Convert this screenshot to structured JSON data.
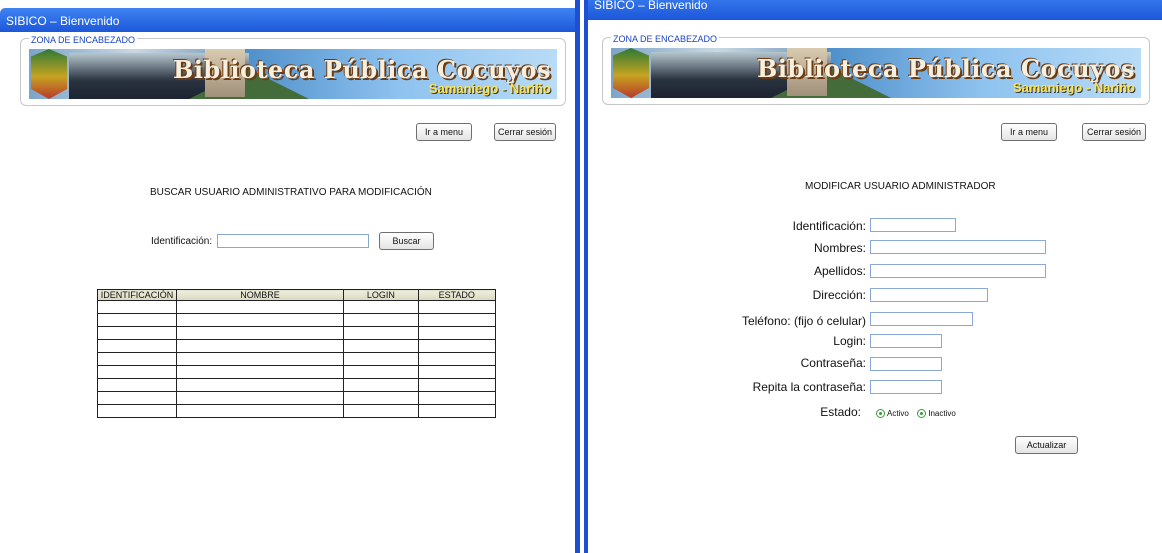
{
  "left": {
    "window_title": "SIBICO – Bienvenido",
    "header_zone_label": "ZONA DE ENCABEZADO",
    "banner_title": "Biblioteca Pública Cocuyos",
    "banner_subtitle": "Samaniego - Nariño",
    "menu_button": "Ir a menu",
    "logout_button": "Cerrar sesión",
    "heading": "BUSCAR USUARIO ADMINISTRATIVO PARA MODIFICACIÓN",
    "id_label": "Identificación:",
    "search_button": "Buscar",
    "table_headers": [
      "IDENTIFICACIÓN",
      "NOMBRE",
      "LOGIN",
      "ESTADO"
    ],
    "table_row_count": 9
  },
  "right": {
    "window_title": "SIBICO – Bienvenido",
    "header_zone_label": "ZONA DE ENCABEZADO",
    "banner_title": "Biblioteca Pública Cocuyos",
    "banner_subtitle": "Samaniego - Nariño",
    "menu_button": "Ir a menu",
    "logout_button": "Cerrar sesión",
    "heading": "MODIFICAR USUARIO ADMINISTRADOR",
    "fields": {
      "identificacion": "Identificación:",
      "nombres": "Nombres:",
      "apellidos": "Apellidos:",
      "direccion": "Dirección:",
      "telefono": "Teléfono: (fijo ó celular)",
      "login": "Login:",
      "contrasena": "Contraseña:",
      "repita": "Repita la contraseña:"
    },
    "estado_label": "Estado:",
    "estado_options": [
      "Activo",
      "Inactivo"
    ],
    "update_button": "Actualizar"
  },
  "colors": {
    "titlebar": "#1c57d9",
    "window_border": "#1e4fd2",
    "input_border": "#8aa7d6"
  }
}
